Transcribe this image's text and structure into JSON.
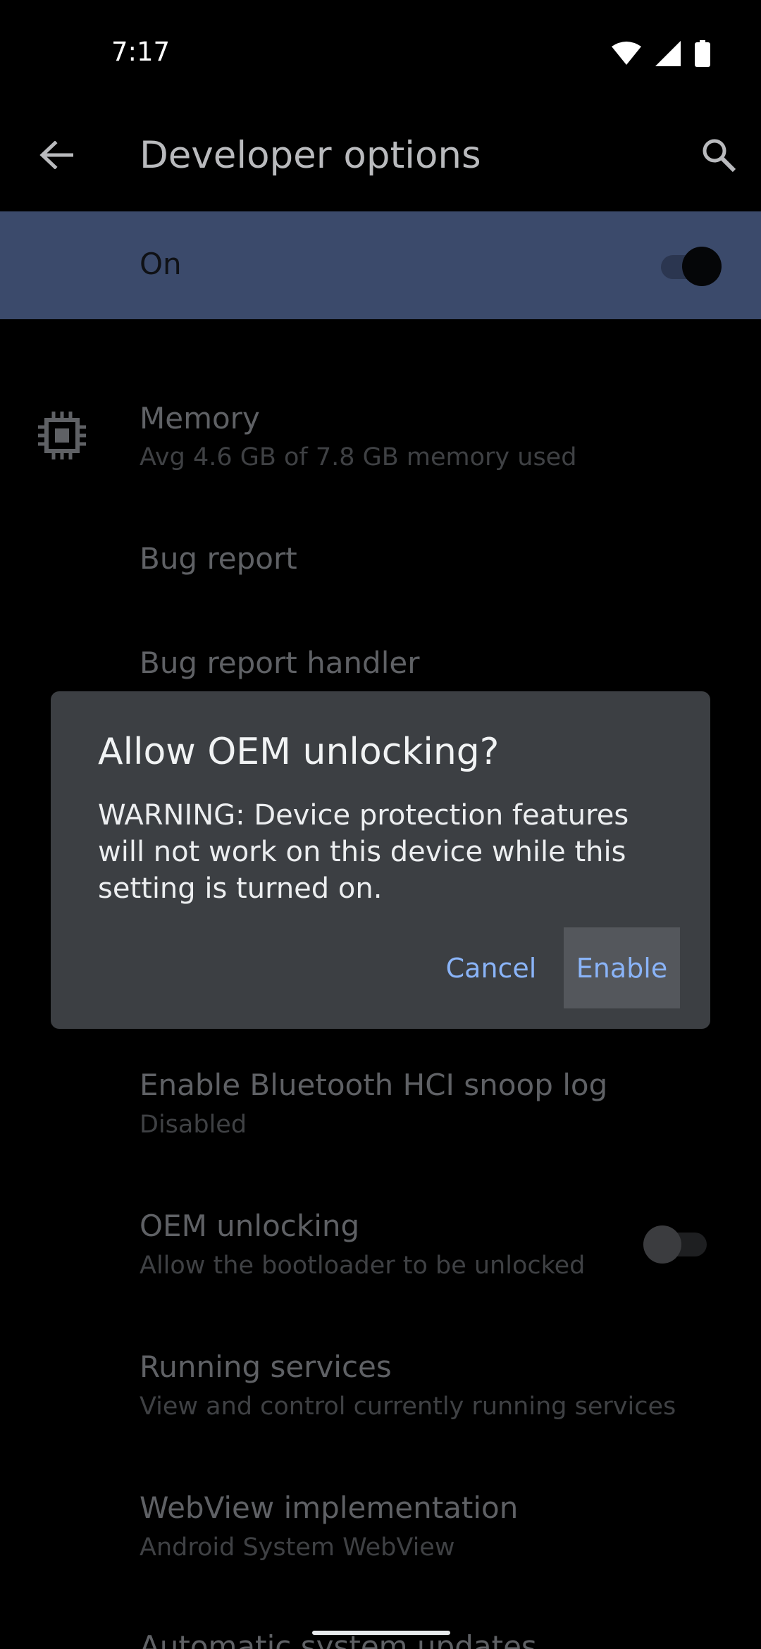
{
  "status_bar": {
    "time": "7:17",
    "icons": [
      "wifi-icon",
      "signal-icon",
      "battery-icon"
    ]
  },
  "app_bar": {
    "title": "Developer options",
    "back_icon": "arrow-back-icon",
    "search_icon": "search-icon"
  },
  "master_switch": {
    "label": "On",
    "checked": true
  },
  "settings": {
    "memory": {
      "title": "Memory",
      "summary": "Avg 4.6 GB of 7.8 GB memory used",
      "icon": "memory-chip-icon"
    },
    "bug_report": {
      "title": "Bug report"
    },
    "bug_report_handler": {
      "title": "Bug report handler"
    },
    "bt_hci": {
      "title": "Enable Bluetooth HCI snoop log",
      "summary": "Disabled"
    },
    "oem_unlocking": {
      "title": "OEM unlocking",
      "summary": "Allow the bootloader to be unlocked",
      "checked": false
    },
    "running_services": {
      "title": "Running services",
      "summary": "View and control currently running services"
    },
    "webview": {
      "title": "WebView implementation",
      "summary": "Android System WebView"
    },
    "auto_updates": {
      "title": "Automatic system updates"
    }
  },
  "dialog": {
    "title": "Allow OEM unlocking?",
    "message": "WARNING: Device protection features will not work on this device while this setting is turned on.",
    "cancel_label": "Cancel",
    "enable_label": "Enable"
  },
  "colors": {
    "accent": "#8ab4f8",
    "master_bar": "#3b4a6b",
    "dialog_bg": "#3c3f43"
  }
}
